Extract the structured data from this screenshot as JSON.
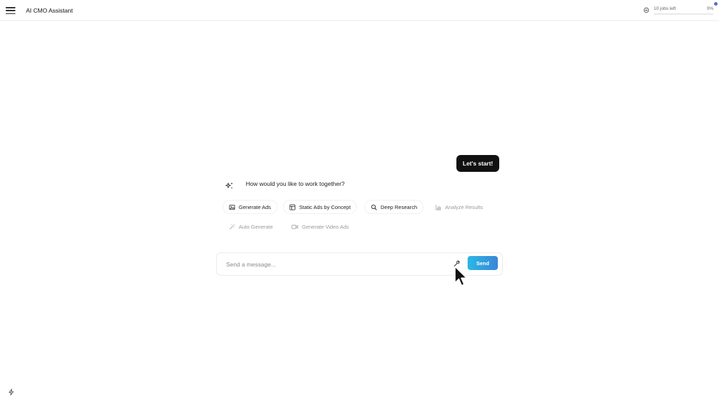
{
  "header": {
    "app_title": "AI CMO Assistant",
    "jobs_label": "10 jobs left",
    "jobs_percent_label": "0%",
    "jobs_progress": 0
  },
  "chat": {
    "user_message": "Let's start!",
    "assistant_message": "How would you like to work together?"
  },
  "options": [
    {
      "label": "Generate Ads",
      "icon": "image-icon",
      "enabled": true
    },
    {
      "label": "Static Ads by Concept",
      "icon": "layout-icon",
      "enabled": true
    },
    {
      "label": "Deep Research",
      "icon": "search-icon",
      "enabled": true
    },
    {
      "label": "Analyze Results",
      "icon": "bar-chart-icon",
      "enabled": false
    },
    {
      "label": "Auto Generate",
      "icon": "magic-wand-icon",
      "enabled": false
    },
    {
      "label": "Generate Video Ads",
      "icon": "video-icon",
      "enabled": false
    }
  ],
  "composer": {
    "placeholder": "Send a message...",
    "value": "",
    "send_label": "Send"
  },
  "colors": {
    "send_gradient_start": "#2bb8e6",
    "send_gradient_end": "#3a86d8",
    "user_bubble": "#111111",
    "notification_dot": "#4a6fd6"
  }
}
